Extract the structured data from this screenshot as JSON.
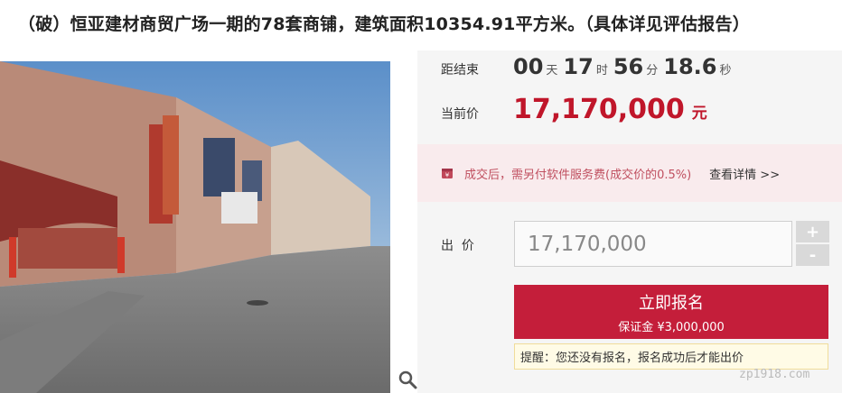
{
  "title": "（破）恒亚建材商贸广场一期的78套商铺，建筑面积10354.91平方米。（具体详见评估报告）",
  "countdown": {
    "label": "距结束",
    "days": "00",
    "days_unit": "天",
    "hours": "17",
    "hours_unit": "时",
    "minutes": "56",
    "minutes_unit": "分",
    "seconds": "18.6",
    "seconds_unit": "秒"
  },
  "current_price": {
    "label": "当前价",
    "value": "17,170,000",
    "unit": "元"
  },
  "notice": {
    "text": "成交后，需另付软件服务费(成交价的0.5%)",
    "link": "查看详情 >>",
    "icon": "fee-icon"
  },
  "bid": {
    "label": "出  价",
    "value": "17,170,000",
    "plus": "+",
    "minus": "-"
  },
  "signup": {
    "label": "立即报名",
    "deposit": "保证金 ¥3,000,000"
  },
  "reminder": "提醒：您还没有报名，报名成功后才能出价",
  "watermark": "zp1918.com",
  "colors": {
    "accent": "#c41e3a",
    "price": "#c0162a",
    "panel": "#f5f5f5",
    "notice_bg": "#f9ebed"
  }
}
